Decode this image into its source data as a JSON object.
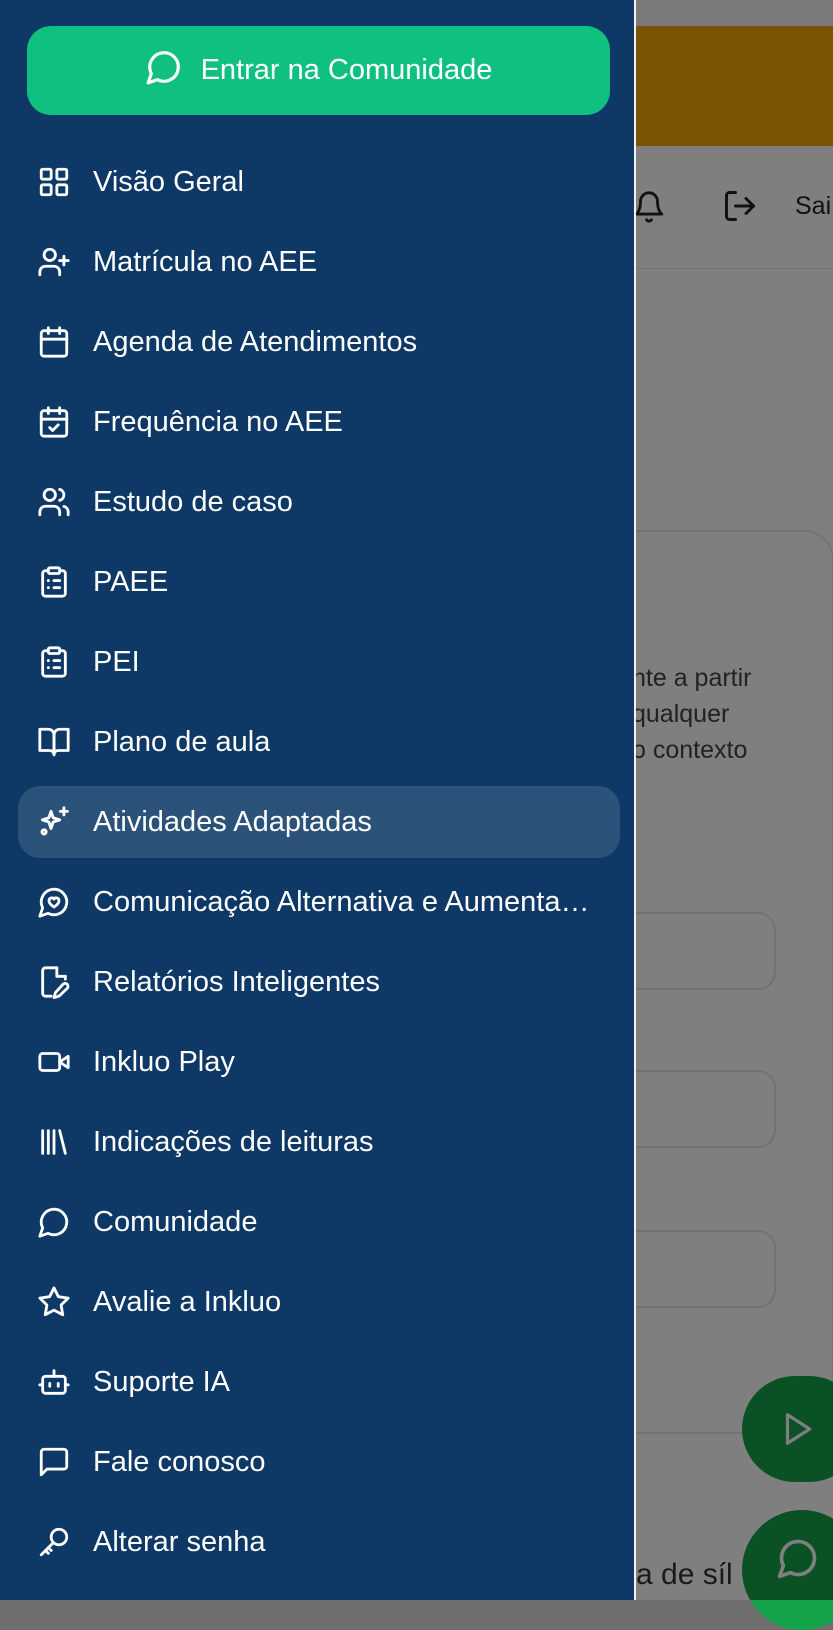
{
  "colors": {
    "drawer_bg": "#0e3866",
    "active_item_bg": "#2b5278",
    "cta_bg": "#10c080",
    "banner_bg": "#f5a60a",
    "fab_bg": "#15a34a"
  },
  "background_page": {
    "header": {
      "bell_icon": "bell-icon",
      "exit_icon": "logout-icon",
      "exit_label_partial": "Sai"
    },
    "card_text_lines": [
      "nte a partir",
      "qualquer",
      "o contexto"
    ],
    "bottom_text_partial": "a de síl",
    "play_fab_icon": "play-icon",
    "chat_fab_icon": "message-circle-icon"
  },
  "drawer": {
    "cta": {
      "label": "Entrar na Comunidade",
      "icon": "message-circle-icon"
    },
    "items": [
      {
        "label": "Visão Geral",
        "icon": "grid-icon",
        "active": false
      },
      {
        "label": "Matrícula no AEE",
        "icon": "user-plus-icon",
        "active": false
      },
      {
        "label": "Agenda de Atendimentos",
        "icon": "calendar-icon",
        "active": false
      },
      {
        "label": "Frequência no AEE",
        "icon": "calendar-check-icon",
        "active": false
      },
      {
        "label": "Estudo de caso",
        "icon": "users-icon",
        "active": false
      },
      {
        "label": "PAEE",
        "icon": "clipboard-list-icon",
        "active": false
      },
      {
        "label": "PEI",
        "icon": "clipboard-list-icon",
        "active": false
      },
      {
        "label": "Plano de aula",
        "icon": "book-open-icon",
        "active": false
      },
      {
        "label": "Atividades Adaptadas",
        "icon": "sparkles-icon",
        "active": true
      },
      {
        "label": "Comunicação Alternativa e Aumentativa",
        "icon": "message-heart-icon",
        "active": false
      },
      {
        "label": "Relatórios Inteligentes",
        "icon": "file-edit-icon",
        "active": false
      },
      {
        "label": "Inkluo Play",
        "icon": "video-icon",
        "active": false
      },
      {
        "label": "Indicações de leituras",
        "icon": "library-icon",
        "active": false
      },
      {
        "label": "Comunidade",
        "icon": "message-circle-icon",
        "active": false
      },
      {
        "label": "Avalie a Inkluo",
        "icon": "star-icon",
        "active": false
      },
      {
        "label": "Suporte IA",
        "icon": "bot-icon",
        "active": false
      },
      {
        "label": "Fale conosco",
        "icon": "message-square-icon",
        "active": false
      },
      {
        "label": "Alterar senha",
        "icon": "key-icon",
        "active": false
      }
    ]
  }
}
